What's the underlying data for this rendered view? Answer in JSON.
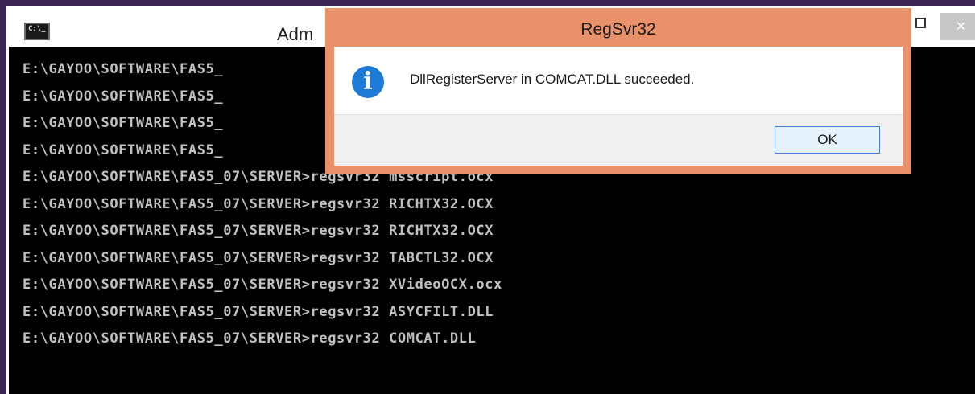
{
  "console": {
    "title": "Adm",
    "icon": "console-window-icon",
    "icon_glyph": "C:\\_",
    "lines": [
      "E:\\GAYOO\\SOFTWARE\\FAS5_",
      "E:\\GAYOO\\SOFTWARE\\FAS5_",
      "E:\\GAYOO\\SOFTWARE\\FAS5_",
      "E:\\GAYOO\\SOFTWARE\\FAS5_",
      "E:\\GAYOO\\SOFTWARE\\FAS5_07\\SERVER>regsvr32 msscript.ocx",
      "E:\\GAYOO\\SOFTWARE\\FAS5_07\\SERVER>regsvr32 RICHTX32.OCX",
      "E:\\GAYOO\\SOFTWARE\\FAS5_07\\SERVER>regsvr32 RICHTX32.OCX",
      "E:\\GAYOO\\SOFTWARE\\FAS5_07\\SERVER>regsvr32 TABCTL32.OCX",
      "E:\\GAYOO\\SOFTWARE\\FAS5_07\\SERVER>regsvr32 XVideoOCX.ocx",
      "E:\\GAYOO\\SOFTWARE\\FAS5_07\\SERVER>regsvr32 ASYCFILT.DLL",
      "E:\\GAYOO\\SOFTWARE\\FAS5_07\\SERVER>regsvr32 COMCAT.DLL"
    ],
    "close_glyph": "×"
  },
  "dialog": {
    "title": "RegSvr32",
    "icon": "info-icon",
    "icon_glyph": "i",
    "message": "DllRegisterServer in COMCAT.DLL succeeded.",
    "ok_label": "OK"
  },
  "colors": {
    "console_bg": "#000000",
    "console_text": "#c0c0c0",
    "dialog_frame": "#e9916a",
    "info_blue": "#1d7ad6",
    "desktop": "#3b2552"
  }
}
